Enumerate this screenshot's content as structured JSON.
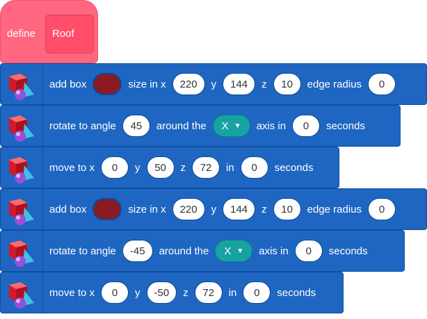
{
  "define": {
    "label": "define",
    "name": "Roof"
  },
  "blocks": [
    {
      "type": "add_box",
      "text": [
        "add box",
        "size in x",
        "y",
        "z",
        "edge radius"
      ],
      "x": "220",
      "y": "144",
      "z": "10",
      "radius": "0",
      "color": "#8c1a24"
    },
    {
      "type": "rotate",
      "text": [
        "rotate to angle",
        "around the",
        "axis in",
        "seconds"
      ],
      "angle": "45",
      "axis": "X",
      "time": "0"
    },
    {
      "type": "move",
      "text": [
        "move to x",
        "y",
        "z",
        "in",
        "seconds"
      ],
      "x": "0",
      "y": "50",
      "z": "72",
      "time": "0"
    },
    {
      "type": "add_box",
      "text": [
        "add box",
        "size in x",
        "y",
        "z",
        "edge radius"
      ],
      "x": "220",
      "y": "144",
      "z": "10",
      "radius": "0",
      "color": "#8c1a24"
    },
    {
      "type": "rotate",
      "text": [
        "rotate to angle",
        "around the",
        "axis in",
        "seconds"
      ],
      "angle": "-45",
      "axis": "X",
      "time": "0"
    },
    {
      "type": "move",
      "text": [
        "move to x",
        "y",
        "z",
        "in",
        "seconds"
      ],
      "x": "0",
      "y": "-50",
      "z": "72",
      "time": "0"
    }
  ],
  "colors": {
    "define": "#ff6680",
    "block": "#1e66c2",
    "dropdown": "#17a3a3"
  },
  "icon": "3d-shapes-icon"
}
